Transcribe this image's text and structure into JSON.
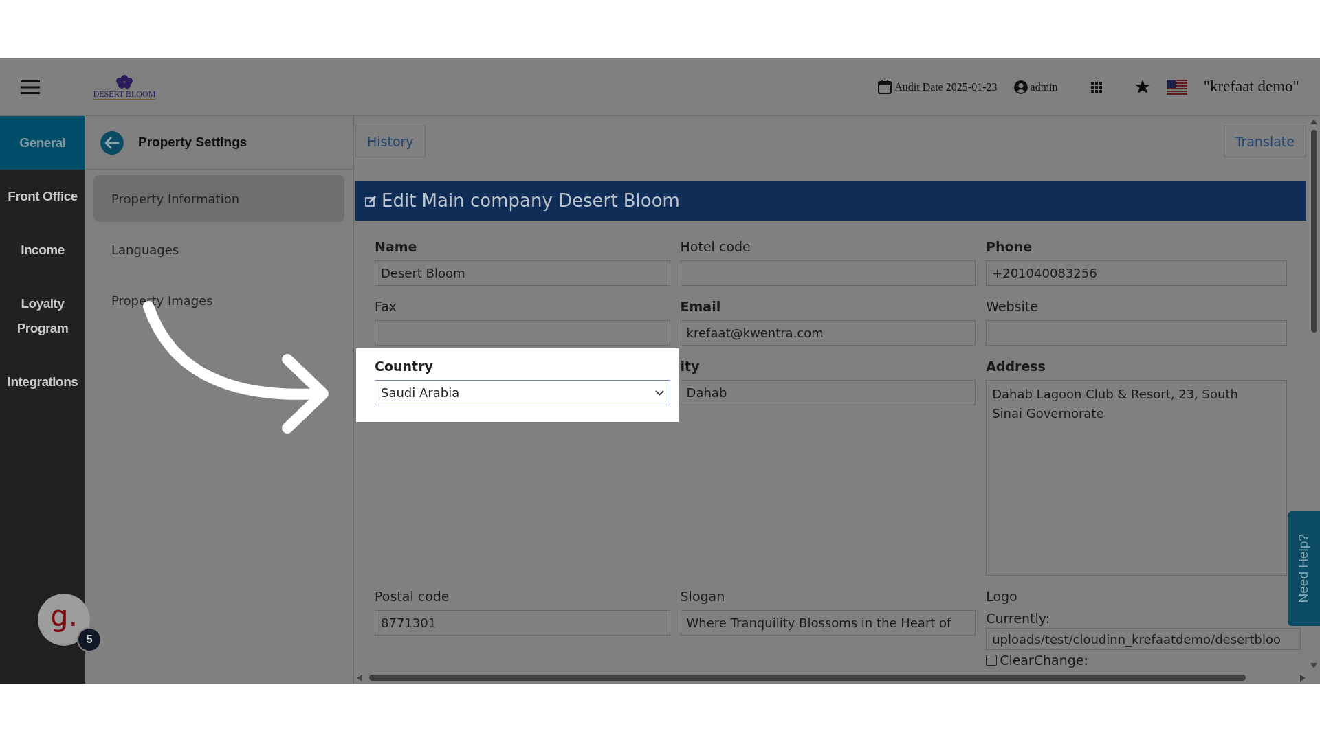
{
  "header": {
    "logo_text": "DESERT BLOOM",
    "audit_date": "Audit Date 2025-01-23",
    "user": "admin",
    "account": "\"krefaat demo\""
  },
  "nav": [
    {
      "label": "General",
      "selected": true
    },
    {
      "label": "Front Office",
      "selected": false
    },
    {
      "label": "Income",
      "selected": false
    },
    {
      "label": "Loyalty Program",
      "selected": false
    },
    {
      "label": "Integrations",
      "selected": false
    }
  ],
  "settings_menu": {
    "title": "Property Settings",
    "items": [
      {
        "label": "Property Information",
        "selected": true
      },
      {
        "label": "Languages",
        "selected": false
      },
      {
        "label": "Property Images",
        "selected": false
      }
    ]
  },
  "toolbar": {
    "history": "History",
    "translate": "Translate"
  },
  "card": {
    "title": "Edit Main company Desert Bloom",
    "fields": [
      {
        "kind": "input",
        "label": "Name",
        "bold": true,
        "value": "Desert Bloom"
      },
      {
        "kind": "input",
        "label": "Hotel code",
        "bold": false
      },
      {
        "kind": "input",
        "label": "Phone",
        "bold": true,
        "value": "+201040083256"
      },
      {
        "kind": "input",
        "label": "Fax",
        "bold": false
      },
      {
        "kind": "input",
        "label": "Email",
        "bold": true,
        "value": "krefaat@kwentra.com"
      },
      {
        "kind": "input",
        "label": "Website",
        "bold": false
      },
      {
        "kind": "select",
        "label": "Country",
        "bold": true,
        "value": "Saudi Arabia",
        "highlighted": true
      },
      {
        "kind": "input",
        "label": "ity",
        "bold": true,
        "value": "Dahab"
      },
      {
        "kind": "textarea",
        "label": "Address",
        "bold": true,
        "value": "Dahab Lagoon Club & Resort, 23, South Sinai Governorate"
      },
      {
        "kind": "input",
        "label": "Postal code",
        "bold": false,
        "value": "8771301"
      },
      {
        "kind": "input",
        "label": "Slogan",
        "bold": false,
        "value": "Where Tranquility Blossoms in the Heart of"
      },
      {
        "kind": "file",
        "label": "Logo",
        "bold": false,
        "current_label": "Currently:",
        "value": "uploads/test/cloudinn_krefaatdemo/desertbloo",
        "clear_label": "ClearChange:",
        "clear_checked": false
      }
    ]
  },
  "help_tab": "Need Help?",
  "chat_widget": {
    "letter": "g.",
    "count": "5"
  }
}
